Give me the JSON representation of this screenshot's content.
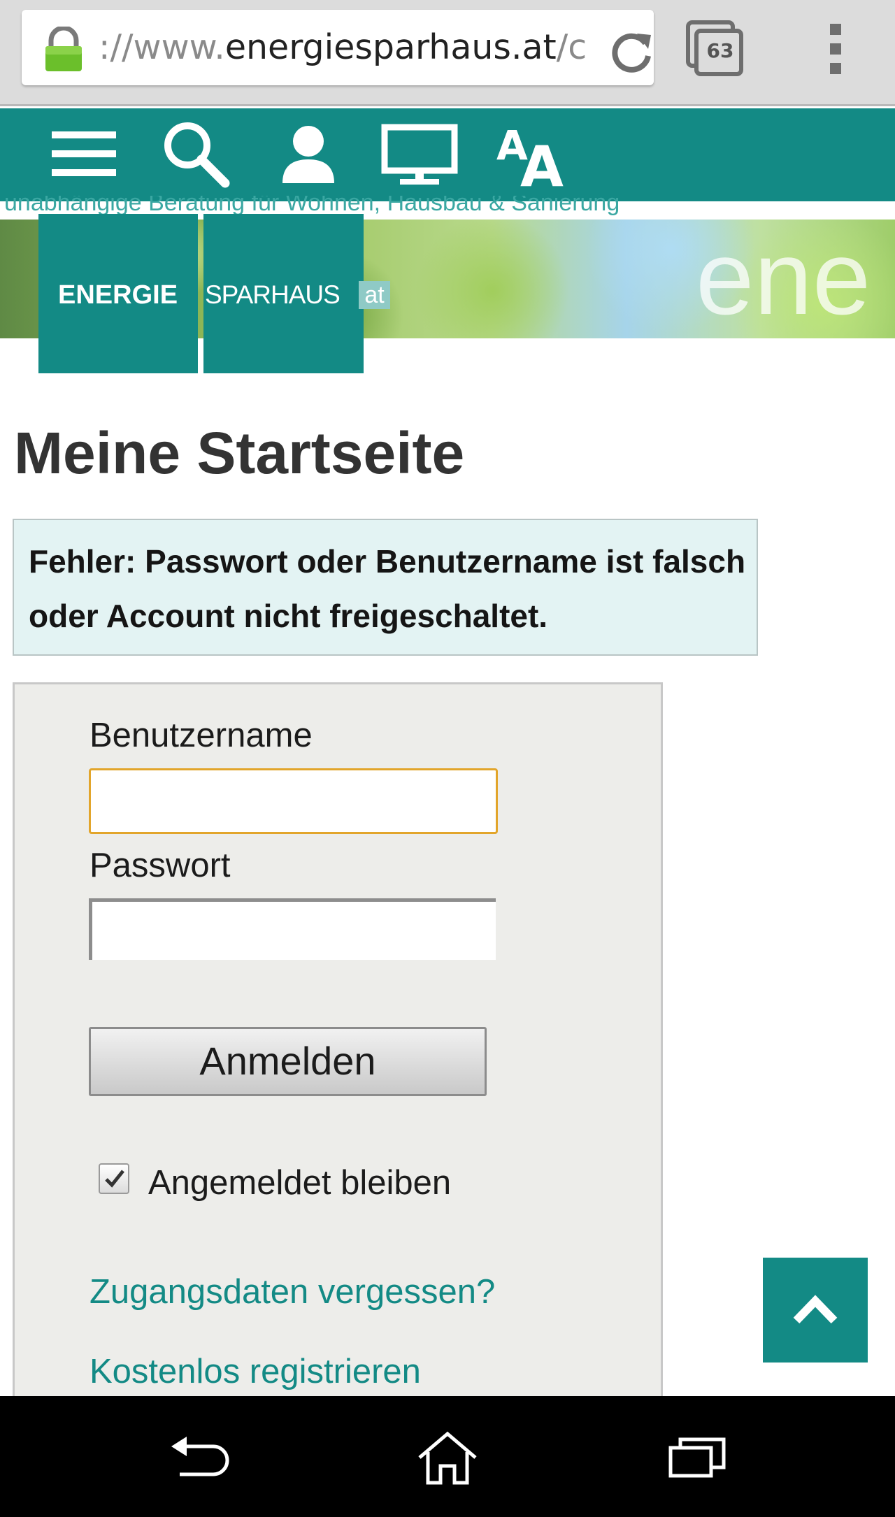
{
  "browser": {
    "url_scheme": "://www.",
    "url_domain": "energiesparhaus.at",
    "url_path": "/c",
    "tab_count": "63"
  },
  "site": {
    "tagline": "unabhängige Beratung für Wohnen, Hausbau & Sanierung",
    "banner_word": "ene",
    "logo": {
      "part1": "ENERGIE",
      "part2": "SPARHAUS",
      "part3": "at"
    },
    "nav_icons": [
      "menu-icon",
      "search-icon",
      "user-icon",
      "monitor-icon",
      "font-size-icon"
    ],
    "accent_color": "#138a85"
  },
  "main": {
    "title": "Meine Startseite",
    "error_message": "Fehler: Passwort oder Benutzername ist falsch oder Account nicht freigeschaltet."
  },
  "login": {
    "username_label": "Benutzername",
    "username_value": "",
    "password_label": "Passwort",
    "password_value": "",
    "submit_label": "Anmelden",
    "remember_label": "Angemeldet bleiben",
    "remember_checked": true,
    "forgot_link": "Zugangsdaten vergessen?",
    "register_link": "Kostenlos registrieren"
  },
  "system_nav": [
    "back-icon",
    "home-icon",
    "recent-apps-icon"
  ]
}
